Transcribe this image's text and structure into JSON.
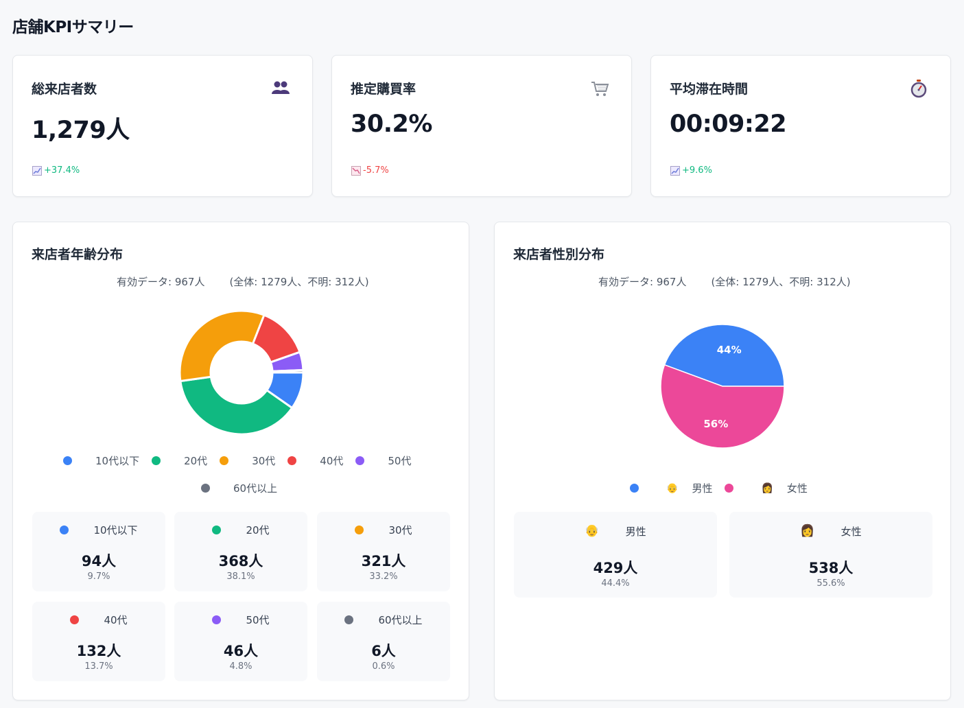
{
  "page_title": "店舗KPIサマリー",
  "kpis": [
    {
      "title": "総来店者数",
      "value": "1,279人",
      "change": "+37.4%",
      "direction": "up",
      "icon": "people-icon"
    },
    {
      "title": "推定購買率",
      "value": "30.2%",
      "change": "-5.7%",
      "direction": "down",
      "icon": "cart-icon"
    },
    {
      "title": "平均滞在時間",
      "value": "00:09:22",
      "change": "+9.6%",
      "direction": "up",
      "icon": "stopwatch-icon"
    }
  ],
  "age": {
    "title": "来店者年齢分布",
    "valid": "有効データ: 967人",
    "total": "(全体: 1279人、不明: 312人)",
    "items": [
      {
        "label": "10代以下",
        "count": "94人",
        "pct": "9.7%",
        "value": 94,
        "color": "#3b82f6"
      },
      {
        "label": "20代",
        "count": "368人",
        "pct": "38.1%",
        "value": 368,
        "color": "#10b981"
      },
      {
        "label": "30代",
        "count": "321人",
        "pct": "33.2%",
        "value": 321,
        "color": "#f59e0b"
      },
      {
        "label": "40代",
        "count": "132人",
        "pct": "13.7%",
        "value": 132,
        "color": "#ef4444"
      },
      {
        "label": "50代",
        "count": "46人",
        "pct": "4.8%",
        "value": 46,
        "color": "#8b5cf6"
      },
      {
        "label": "60代以上",
        "count": "6人",
        "pct": "0.6%",
        "value": 6,
        "color": "#6b7280"
      }
    ]
  },
  "gender": {
    "title": "来店者性別分布",
    "valid": "有効データ: 967人",
    "total": "(全体: 1279人、不明: 312人)",
    "items": [
      {
        "label": "男性",
        "emoji": "👴",
        "count": "429人",
        "pct": "44.4%",
        "value": 429,
        "slice_label": "44%",
        "color": "#3b82f6"
      },
      {
        "label": "女性",
        "emoji": "👩",
        "count": "538人",
        "pct": "55.6%",
        "value": 538,
        "slice_label": "56%",
        "color": "#ec4899"
      }
    ]
  },
  "chart_data": [
    {
      "type": "pie",
      "variant": "donut",
      "categories": [
        "10代以下",
        "20代",
        "30代",
        "40代",
        "50代",
        "60代以上"
      ],
      "values": [
        94,
        368,
        321,
        132,
        46,
        6
      ],
      "legend": "bottom"
    },
    {
      "type": "pie",
      "categories": [
        "男性",
        "女性"
      ],
      "values": [
        429,
        538
      ],
      "data_labels": [
        "44%",
        "56%"
      ],
      "legend": "bottom"
    }
  ]
}
